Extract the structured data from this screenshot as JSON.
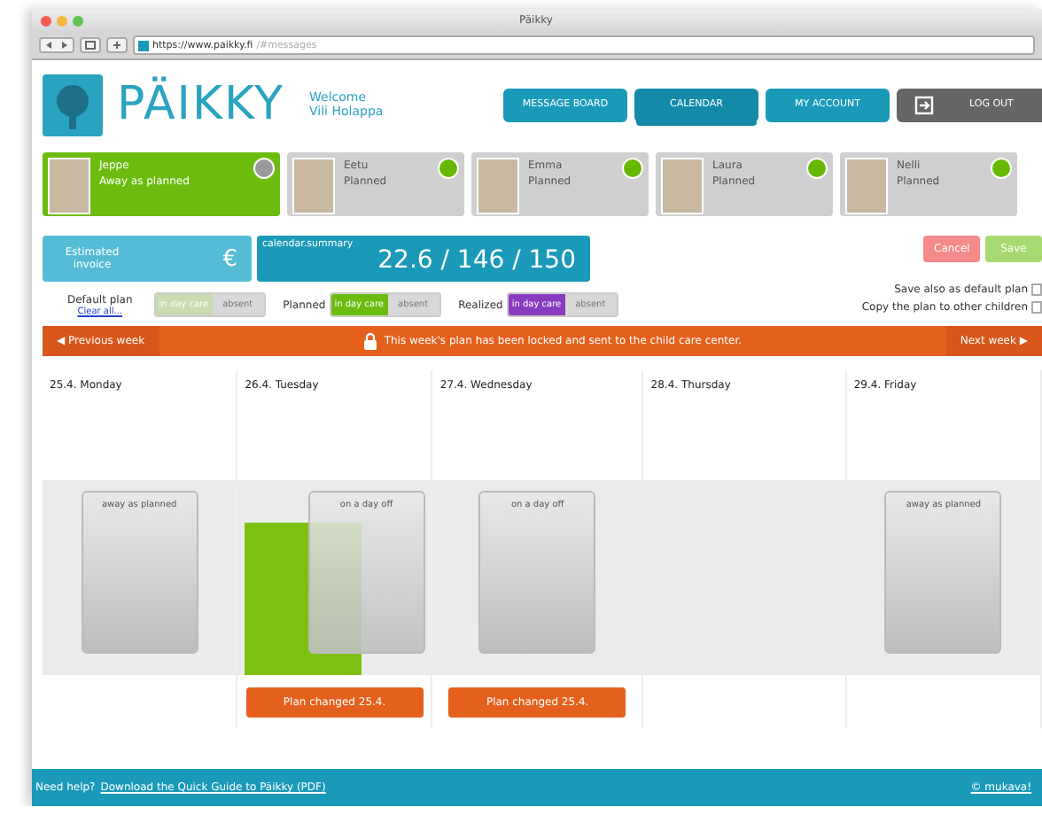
{
  "window": {
    "title": "Päikky",
    "url_host": "https://www.paikky.fi",
    "url_path": "/#messages"
  },
  "header": {
    "logo": "PÄIKKY",
    "welcome": "Welcome",
    "user": "Vili Holappa",
    "nav": [
      {
        "label": "MESSAGE BOARD",
        "selected": false
      },
      {
        "label": "CALENDAR",
        "selected": true
      },
      {
        "label": "MY ACCOUNT",
        "selected": false
      },
      {
        "label": "LOG OUT",
        "selected": false
      }
    ]
  },
  "children": [
    {
      "name": "Jeppe",
      "status": "Away as planned",
      "selected": true,
      "color": "#9a9a9a"
    },
    {
      "name": "Eetu",
      "status": "Planned",
      "selected": false,
      "color": "#66b800"
    },
    {
      "name": "Emma",
      "status": "Planned",
      "selected": false,
      "color": "#66b800"
    },
    {
      "name": "Laura",
      "status": "Planned",
      "selected": false,
      "color": "#66b800"
    },
    {
      "name": "Nelli",
      "status": "Planned",
      "selected": false,
      "color": "#66b800"
    }
  ],
  "invoice": {
    "label": "Estimated invoice",
    "symbol": "€"
  },
  "summary": {
    "label": "calendar.summary",
    "value": "22.6 / 146 / 150"
  },
  "actions": [
    {
      "label": "Cancel",
      "kind": "cancel"
    },
    {
      "label": "Save",
      "kind": "save"
    }
  ],
  "legends": [
    {
      "label": "Default plan",
      "link": "Clear all...",
      "on": "in day care",
      "off": "absent",
      "color": "#c8dcb0"
    },
    {
      "label": "Planned",
      "on": "in day care",
      "off": "absent",
      "color": "#6cbc10"
    },
    {
      "label": "Realized",
      "on": "in day care",
      "off": "absent",
      "color": "#8a3cc0"
    }
  ],
  "options": [
    {
      "label": "Save also as default plan",
      "checked": false
    },
    {
      "label": "Copy the plan to other children",
      "checked": false
    }
  ],
  "week_bar": {
    "previous": "◀ Previous week",
    "message": "This week's plan has been locked and sent to the child care center.",
    "next": "Next week ▶"
  },
  "days": [
    {
      "title": "25.4. Monday",
      "card": "away as planned",
      "green_bar": false
    },
    {
      "title": "26.4. Tuesday",
      "card": "on a day off",
      "green_bar": true,
      "change": "Plan changed 25.4."
    },
    {
      "title": "27.4. Wednesday",
      "card": "on a day off",
      "green_bar": false,
      "change": "Plan changed 25.4."
    },
    {
      "title": "28.4. Thursday",
      "green_bar": false
    },
    {
      "title": "29.4. Friday",
      "card": "away as planned",
      "green_bar": false
    }
  ],
  "footer": {
    "text": "Need help?",
    "link": "Download the Quick Guide to Päikky (PDF)",
    "right": "© mukava!"
  }
}
